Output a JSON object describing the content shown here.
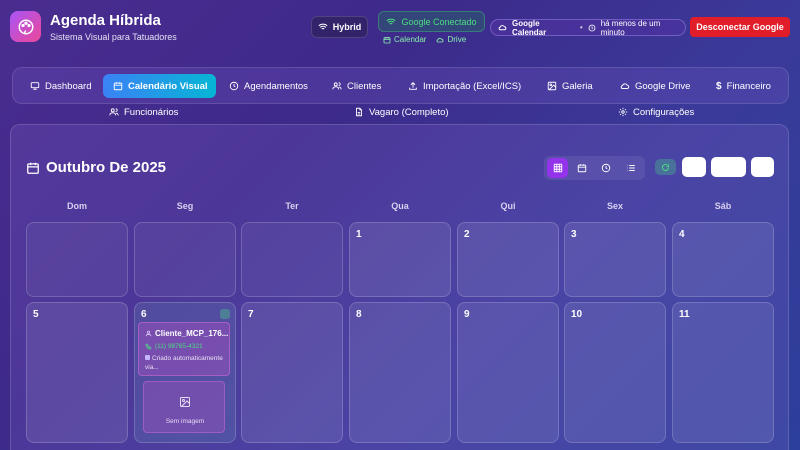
{
  "header": {
    "title": "Agenda Híbrida",
    "subtitle": "Sistema Visual para Tatuadores",
    "mode": "Hybrid",
    "google_status": "Google Conectado",
    "calendar_link": "Calendar",
    "drive_link": "Drive",
    "gcal_label": "Google Calendar",
    "gcal_sep": "•",
    "gcal_time": "há menos de um minuto",
    "disconnect": "Desconectar Google"
  },
  "nav": {
    "items": [
      {
        "label": "Dashboard",
        "icon": "monitor-icon"
      },
      {
        "label": "Calendário Visual",
        "icon": "calendar-icon",
        "active": true
      },
      {
        "label": "Agendamentos",
        "icon": "clock-icon"
      },
      {
        "label": "Clientes",
        "icon": "users-icon"
      },
      {
        "label": "Importação (Excel/ICS)",
        "icon": "upload-icon"
      },
      {
        "label": "Galeria",
        "icon": "image-icon"
      },
      {
        "label": "Google Drive",
        "icon": "cloud-icon"
      },
      {
        "label": "Financeiro",
        "icon": "dollar-icon"
      }
    ],
    "row2": [
      {
        "label": "Funcionários",
        "icon": "users-icon"
      },
      {
        "label": "Vagaro (Completo)",
        "icon": "file-icon"
      },
      {
        "label": "Configurações",
        "icon": "gear-icon"
      }
    ]
  },
  "calendar": {
    "month_title": "Outubro De 2025",
    "weekdays": [
      "Dom",
      "Seg",
      "Ter",
      "Qua",
      "Qui",
      "Sex",
      "Sáb"
    ],
    "week1": [
      "",
      "",
      "",
      "1",
      "2",
      "3",
      "4"
    ],
    "week2": [
      "5",
      "6",
      "7",
      "8",
      "9",
      "10",
      "11"
    ],
    "event": {
      "client": "Cliente_MCP_176...",
      "phone": "(11) 98765-4321",
      "note": "Criado automaticamente via...",
      "image_placeholder": "Sem imagem"
    }
  },
  "colors": {
    "accent": "#9333ea",
    "active_nav": "#3b82f6",
    "connected": "#4ade80",
    "danger": "#e11d2a"
  }
}
